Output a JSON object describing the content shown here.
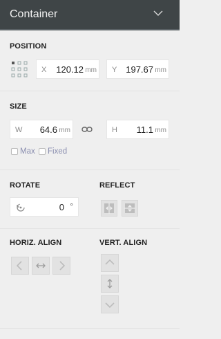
{
  "header": {
    "title": "Container",
    "toggle_icon": "chevron-down-icon"
  },
  "position": {
    "label": "POSITION",
    "anchor_icon": "anchor-grid-icon",
    "x": {
      "label": "X",
      "value": "120.12",
      "unit": "mm"
    },
    "y": {
      "label": "Y",
      "value": "197.67",
      "unit": "mm"
    }
  },
  "size": {
    "label": "SIZE",
    "w": {
      "label": "W",
      "value": "64.6",
      "unit": "mm"
    },
    "h": {
      "label": "H",
      "value": "11.1",
      "unit": "mm"
    },
    "link_icon": "chain-link-icon",
    "max_label": "Max",
    "fixed_label": "Fixed"
  },
  "rotate": {
    "label": "ROTATE",
    "value": "0",
    "unit": "°",
    "icon": "rotate-icon"
  },
  "reflect": {
    "label": "REFLECT",
    "icons": [
      "flip-horizontal-icon",
      "flip-vertical-icon"
    ]
  },
  "horiz_align": {
    "label": "HORIZ. ALIGN",
    "icons": [
      "align-left-icon",
      "align-center-horizontal-icon",
      "align-right-icon"
    ]
  },
  "vert_align": {
    "label": "VERT. ALIGN",
    "icons": [
      "align-top-icon",
      "align-middle-vertical-icon",
      "align-bottom-icon"
    ]
  }
}
